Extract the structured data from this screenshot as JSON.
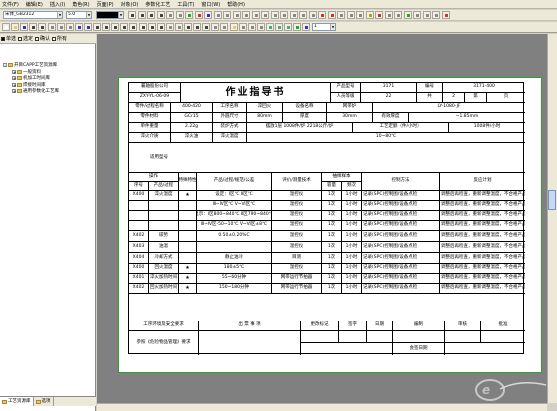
{
  "menu": [
    "文件(F)",
    "编辑(E)",
    "插入(I)",
    "角色(R)",
    "页面(P)",
    "对象(O)",
    "参数化工艺",
    "工具(T)",
    "窗口(W)",
    "帮助(H)"
  ],
  "toolbar": {
    "font": "宋体_GB2312",
    "size": "5.0"
  },
  "toolbar2": {
    "zoom": "1"
  },
  "left_panel": {
    "checks": [
      {
        "label": "单选",
        "checked": true
      },
      {
        "label": "选定",
        "checked": false
      },
      {
        "label": "确认",
        "checked": false
      },
      {
        "label": "所有",
        "checked": false
      }
    ],
    "tree": [
      {
        "label": "开目CAPP工艺资源库",
        "expander": "-"
      },
      {
        "label": "一般资料",
        "expander": "+"
      },
      {
        "label": "机加工时间库",
        "expander": "+"
      },
      {
        "label": "焊接时间库",
        "expander": "+"
      },
      {
        "label": "通用参数化工艺库",
        "expander": "+"
      }
    ],
    "tabs": [
      "工艺资源库",
      "选项"
    ]
  },
  "form": {
    "company": "襄轴股份公司",
    "doc_no": "ZXY-YL-06-09",
    "title": "作业指导书",
    "prod_model_label": "产品型号",
    "prod_model": "3171",
    "part_label": "编号",
    "part_no": "3171-400",
    "ver_label": "人员等级",
    "ver": "22",
    "sheet_label": "共",
    "sheet": "2",
    "page_label": "第",
    "page": "页",
    "r3": [
      "零件/过程名称",
      "400-420",
      "工序名称",
      "淬回火",
      "设备名称",
      "网带炉",
      "LY-1080-JF"
    ],
    "r4": [
      "零件材料",
      "GCr15",
      "外圆尺寸",
      "80mm",
      "厚度",
      "30mm",
      "有效厚度",
      "~1.85mm"
    ],
    "r5": [
      "单件重量",
      "2.22g",
      "装炉方式",
      "摆放1层 1008件/炉 2218公斤/炉",
      "工艺定额（件/小时）",
      "1008件/小时"
    ],
    "r6": [
      "淬火介质",
      "淬火油",
      "淬火温度",
      "10~80℃"
    ],
    "applicable": "适用型号",
    "h": [
      "操作",
      "",
      "特殊特性",
      "产品/过程/规范/公差",
      "评价/测量技术",
      "抽样样本",
      "",
      "控制方法",
      "反应计划"
    ],
    "h2": [
      "序号",
      "产品/过程",
      "容量",
      "频次"
    ],
    "rows": [
      [
        "X400",
        "淬火温度",
        "★",
        "设定：Ⅰ区℃ Ⅱ区℃",
        "温控仪",
        "1次",
        "1小时",
        "记录(SPC)控制图/设备点检",
        "调整后再检查，重新调整温度，不合格产品隔离"
      ],
      [
        "",
        "",
        "",
        "Ⅲ~Ⅳ区℃ Ⅴ~Ⅵ区℃",
        "温控仪",
        "1次",
        "1小时",
        "记录(SPC)控制图/设备点检",
        "调整后再检查，重新调整温度，不合格产品隔离"
      ],
      [
        "",
        "",
        "",
        "显示：Ⅰ区800~840℃ Ⅱ区790~840℃",
        "温控仪",
        "1次",
        "1小时",
        "记录(SPC)控制图/设备点检",
        "调整后再检查，重新调整温度，不合格产品隔离"
      ],
      [
        "",
        "",
        "",
        "Ⅲ~Ⅳ区-50~10℃ Ⅴ~Ⅵ区±8℃",
        "温控仪",
        "1次",
        "1小时",
        "记录(SPC)控制图/设备点检",
        "调整后再检查，重新调整温度，不合格产品隔离"
      ],
      [
        "X402",
        "碳势",
        "",
        "0.50±0.20%C",
        "温控仪",
        "1次",
        "1小时",
        "记录(SPC)控制图/设备点检",
        "调整后再检查，重新调整温度，不合格产品隔离"
      ],
      [
        "X403",
        "油温",
        "",
        "",
        "温控仪",
        "1次",
        "1小时",
        "记录(SPC)控制图/设备点检",
        "调整后再检查，重新调整温度，不合格产品隔离"
      ],
      [
        "X404",
        "冷却方式",
        "",
        "静止油冷",
        "目测",
        "1次",
        "1小时",
        "记录(SPC)控制图/设备点检",
        "调整后再检查，重新调整温度，不合格产品隔离"
      ],
      [
        "X400",
        "回火温度",
        "★",
        "180±5℃",
        "温控仪",
        "1次",
        "1小时",
        "记录(SPC)控制图/设备点检",
        "调整后再检查，重新调整温度，不合格产品隔离"
      ],
      [
        "X401",
        "淬火加热时间",
        "★",
        "55~60分钟",
        "网带运行节拍器",
        "1次",
        "1小时",
        "记录(SPC)控制图/设备点检",
        "调整后再检查，重新调整温度，不合格产品隔离"
      ],
      [
        "X402",
        "回火加热时间",
        "★",
        "150~180分钟",
        "网带运行节拍器",
        "1次",
        "1小时",
        "记录(SPC)控制图/设备点检",
        "调整后再检查，重新调整温度，不合格产品隔离"
      ]
    ],
    "footer": [
      "工序环境及安全要求",
      "出 票 事 项",
      "更改标记",
      "签字",
      "日期",
      "编制",
      "审核",
      "批准"
    ],
    "footer2": [
      "参照《危险物品管理》要求"
    ],
    "footer_date": "会签日期"
  },
  "colors": {
    "canvas": "#808080",
    "paper_border": "#30a030",
    "menubar": "#ece9d8"
  }
}
